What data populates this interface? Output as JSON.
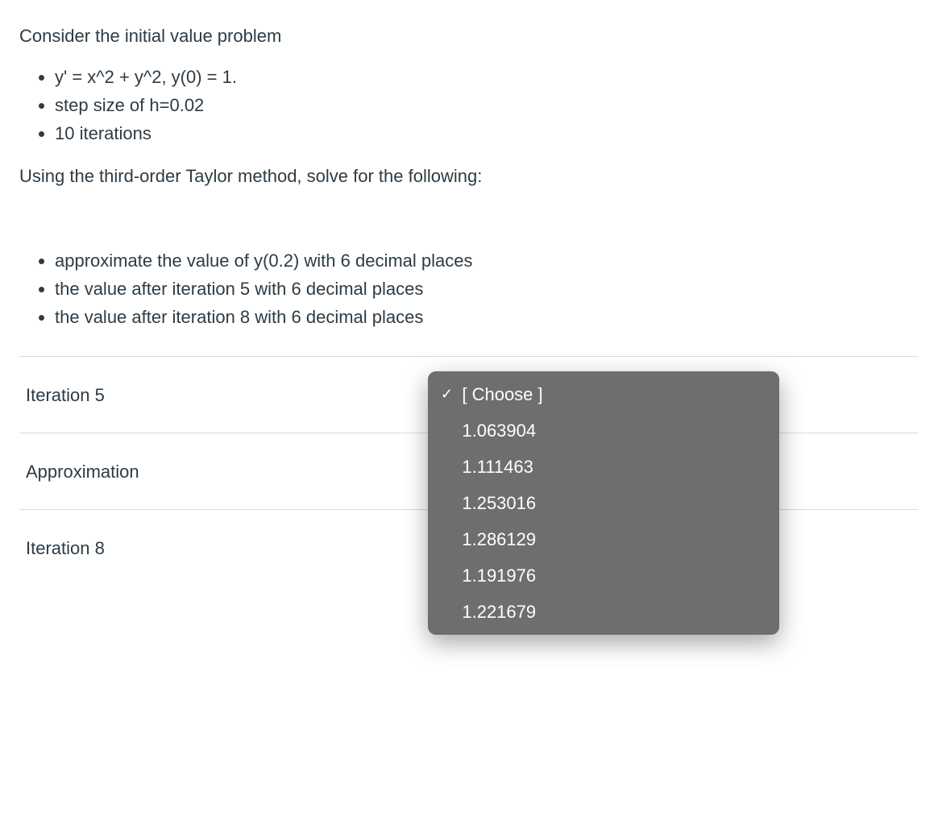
{
  "question": {
    "intro": "Consider the initial value problem",
    "given": [
      "y' = x^2 + y^2, y(0) = 1.",
      "step size of h=0.02",
      "10 iterations"
    ],
    "method_instruction": "Using the third-order Taylor method, solve for the following:",
    "tasks": [
      "approximate the value of y(0.2) with 6 decimal places",
      "the value after iteration 5 with 6 decimal places",
      "the value after iteration 8 with 6 decimal places"
    ]
  },
  "matching": {
    "rows": [
      {
        "label": "Iteration 5"
      },
      {
        "label": "Approximation"
      },
      {
        "label": "Iteration 8"
      }
    ]
  },
  "dropdown": {
    "selected_label": "[ Choose ]",
    "options": [
      {
        "text": "[ Choose ]",
        "selected": true
      },
      {
        "text": "1.063904",
        "selected": false
      },
      {
        "text": "1.111463",
        "selected": false
      },
      {
        "text": "1.253016",
        "selected": false
      },
      {
        "text": "1.286129",
        "selected": false
      },
      {
        "text": "1.191976",
        "selected": false
      },
      {
        "text": "1.221679",
        "selected": false
      }
    ]
  }
}
